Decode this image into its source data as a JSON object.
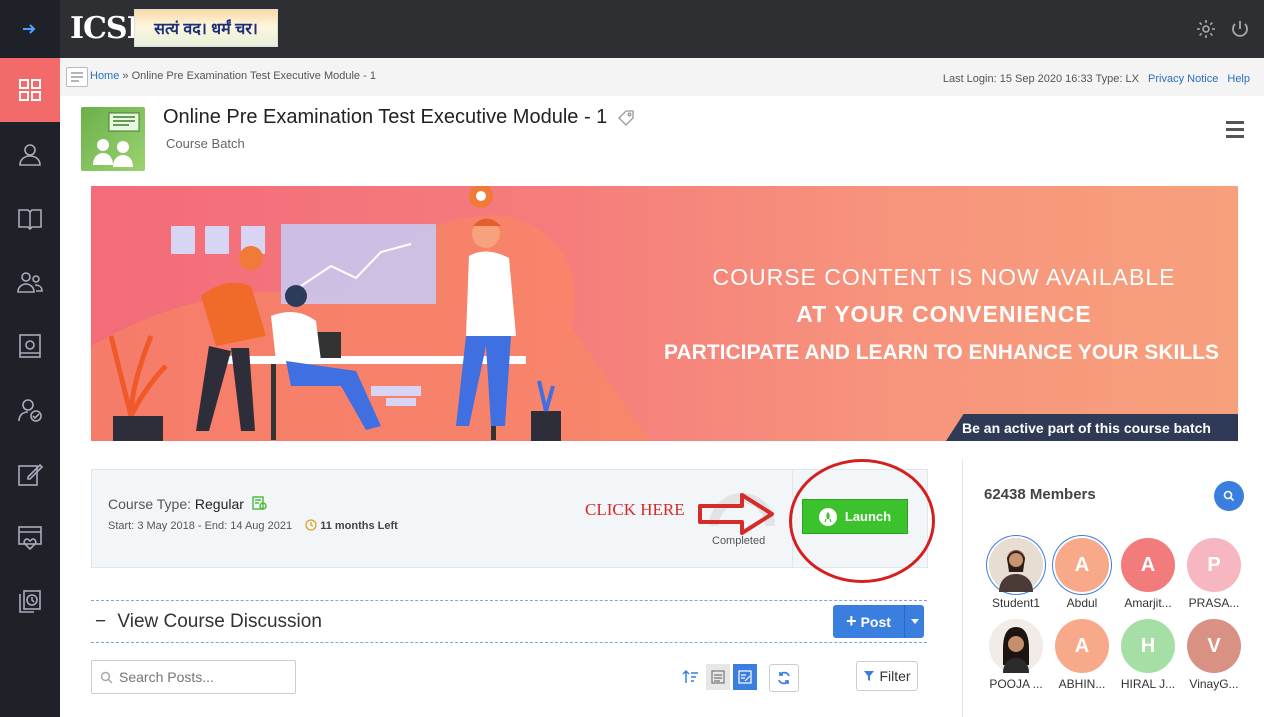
{
  "topbar": {
    "logo_mark": "ICSI",
    "motto": "सत्यं वद। धर्मं चर।"
  },
  "breadcrumb": {
    "home": "Home",
    "separator": " » ",
    "current": "Online Pre Examination Test Executive Module - 1"
  },
  "session": {
    "last_login": "Last Login: 15 Sep 2020 16:33 Type: LX",
    "privacy": "Privacy Notice",
    "help": "Help"
  },
  "course": {
    "title": "Online Pre Examination Test Executive Module - 1",
    "subtitle": "Course Batch"
  },
  "banner": {
    "line1": "COURSE CONTENT IS NOW AVAILABLE",
    "line2": "AT YOUR CONVENIENCE",
    "line3": "PARTICIPATE AND LEARN TO ENHANCE YOUR SKILLS",
    "tag": "Be an active part of this course batch"
  },
  "course_card": {
    "type_label": "Course Type: ",
    "type_value": "Regular",
    "dates": "Start: 3 May 2018 - End: 14 Aug 2021",
    "time_left": "11 months Left",
    "click_here": "CLICK HERE",
    "completed": "Completed",
    "launch": "Launch"
  },
  "discussion": {
    "toggle": "−",
    "title": "View Course Discussion",
    "post": "Post",
    "search_placeholder": "Search Posts...",
    "filter": "Filter"
  },
  "members": {
    "count": "62438 Members",
    "list": [
      {
        "name": "Student1",
        "initial": "",
        "color": "#d9c7b8"
      },
      {
        "name": "Abdul",
        "initial": "A",
        "color": "#f8a98a"
      },
      {
        "name": "Amarjit...",
        "initial": "A",
        "color": "#f27b7b"
      },
      {
        "name": "PRASA...",
        "initial": "P",
        "color": "#f7b7c0"
      },
      {
        "name": "POOJA ...",
        "initial": "",
        "color": "#e8d5cf"
      },
      {
        "name": "ABHIN...",
        "initial": "A",
        "color": "#f8a98a"
      },
      {
        "name": "HIRAL J...",
        "initial": "H",
        "color": "#a6dfa6"
      },
      {
        "name": "VinayG...",
        "initial": "V",
        "color": "#d99184"
      }
    ]
  },
  "colors": {
    "sidebar": "#1f2128",
    "sidebar_active": "#f36a6a",
    "topbar": "#2e2f33",
    "accent": "#3a7fe0",
    "launch": "#3cc22c",
    "annotation": "#d42b2b"
  }
}
